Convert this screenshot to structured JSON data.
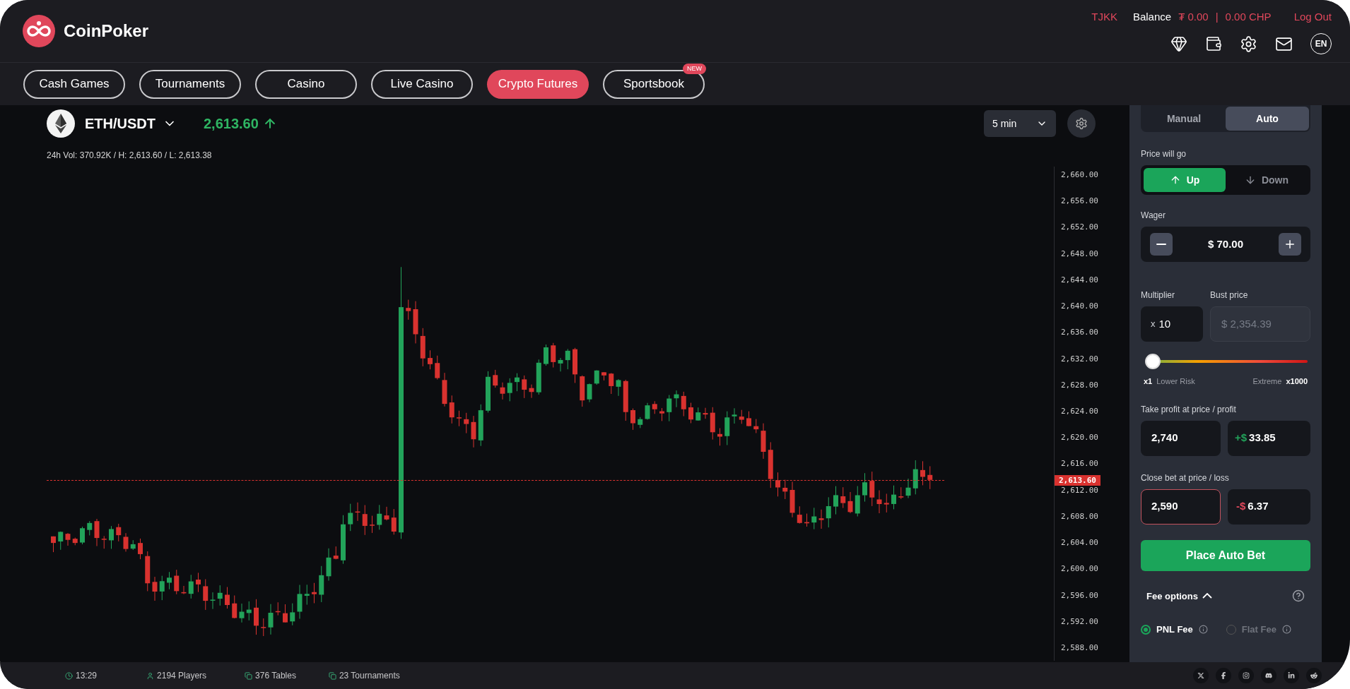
{
  "header": {
    "brand": "CoinPoker",
    "user": "TJKK",
    "balance_label": "Balance",
    "balance_tokens": "₮ 0.00",
    "separator": "|",
    "balance_chp": "0.00 CHP",
    "logout": "Log Out",
    "language": "EN"
  },
  "nav_tabs": [
    {
      "label": "Cash Games",
      "selected": false
    },
    {
      "label": "Tournaments",
      "selected": false
    },
    {
      "label": "Casino",
      "selected": false
    },
    {
      "label": "Live Casino",
      "selected": false
    },
    {
      "label": "Crypto Futures",
      "selected": true
    },
    {
      "label": "Sportsbook",
      "selected": false,
      "badge": "NEW"
    }
  ],
  "market": {
    "pair": "ETH/USDT",
    "price": "2,613.60",
    "stats": "24h Vol: 370.92K / H: 2,613.60 / L: 2,613.38",
    "interval": "5 min",
    "current_price_tag": "2,613.60",
    "price_axis": [
      "2,660.00",
      "2,656.00",
      "2,652.00",
      "2,648.00",
      "2,644.00",
      "2,640.00",
      "2,636.00",
      "2,632.00",
      "2,628.00",
      "2,624.00",
      "2,620.00",
      "2,616.00",
      "2,612.00",
      "2,608.00",
      "2,604.00",
      "2,600.00",
      "2,596.00",
      "2,592.00",
      "2,588.00"
    ]
  },
  "bet_panel": {
    "modes": [
      {
        "label": "Manual",
        "selected": false
      },
      {
        "label": "Auto",
        "selected": true
      }
    ],
    "direction_label": "Price will go",
    "directions": [
      {
        "label": "Up",
        "kind": "up",
        "selected": true
      },
      {
        "label": "Down",
        "kind": "down",
        "selected": false
      }
    ],
    "wager_label": "Wager",
    "wager": "$ 70.00",
    "multiplier_label": "Multiplier",
    "multiplier_prefix": "x",
    "multiplier": "10",
    "bust_label": "Bust price",
    "bust_price": "$ 2,354.39",
    "risk": {
      "level": 0.01,
      "min": "x1",
      "min_label": "Lower Risk",
      "max_label": "Extreme",
      "max": "x1000"
    },
    "take_profit_label": "Take profit at price / profit",
    "take_profit_price": "2,740",
    "profit_sign": "+$",
    "profit": "33.85",
    "stop_label": "Close bet at price / loss",
    "stop_price": "2,590",
    "loss_sign": "-$",
    "loss": "6.37",
    "place_button": "Place Auto Bet",
    "fee_label": "Fee options",
    "fee_expanded": true,
    "fees": [
      {
        "label": "PNL Fee",
        "selected": true
      },
      {
        "label": "Flat Fee",
        "selected": false
      }
    ]
  },
  "status_bar": {
    "time": "13:29",
    "players": "2194 Players",
    "tables": "376 Tables",
    "tournaments": "23 Tournaments"
  }
}
